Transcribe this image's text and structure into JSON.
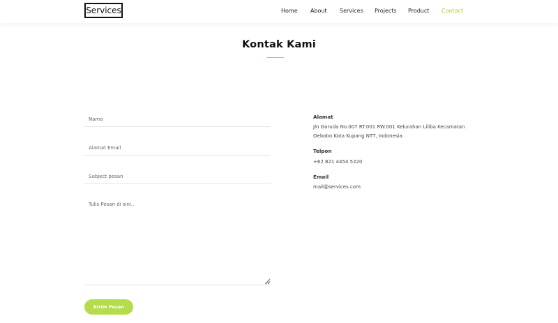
{
  "header": {
    "logo": "Services",
    "nav": [
      {
        "label": "Home",
        "active": false
      },
      {
        "label": "About",
        "active": false
      },
      {
        "label": "Services",
        "active": false
      },
      {
        "label": "Projects",
        "active": false
      },
      {
        "label": "Product",
        "active": false
      },
      {
        "label": "Contact",
        "active": true
      }
    ],
    "accent_color": "#a8d23c"
  },
  "contact": {
    "title": "Kontak Kami",
    "form": {
      "name_placeholder": "Nama",
      "email_placeholder": "Alamat Email",
      "subject_placeholder": "Subject pesan",
      "message_placeholder": "Tulis Pesan di sini..",
      "submit_label": "Kirim Pesan",
      "submit_color": "#b5dc4a"
    },
    "info": {
      "address_label": "Alamat",
      "address_line1": "Jln Garuda No.007 RT.001 RW.001 Kelurahan Liliba Kecamatan",
      "address_line2": "Oebobo Kota Kupang NTT, Indonesia",
      "phone_label": "Telpon",
      "phone": "+62 821 4454 5220",
      "email_label": "Email",
      "email": "mail@services.com"
    }
  }
}
